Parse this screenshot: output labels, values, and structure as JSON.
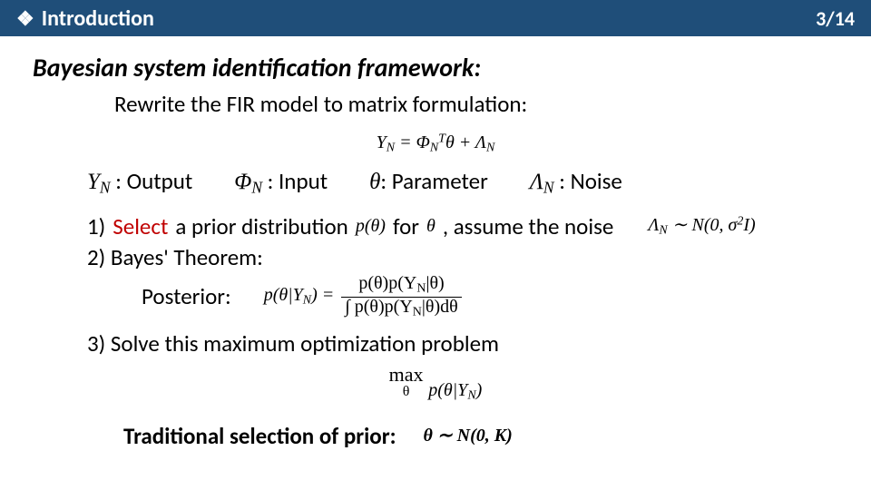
{
  "header": {
    "bullet": "❖",
    "title": "Introduction",
    "page": "3/14"
  },
  "heading": "Bayesian system identification framework:",
  "rewrite": "Rewrite the FIR model to matrix formulation:",
  "main_eq": "Y_N = Φ_N^T θ + Λ_N",
  "defs": {
    "output_sym": "Y_N",
    "output_lbl": ": Output",
    "input_sym": "Φ_N",
    "input_lbl": ": Input",
    "param_sym": "θ",
    "param_lbl": ": Parameter",
    "noise_sym": "Λ_N",
    "noise_lbl": ": Noise"
  },
  "step1_a": "1) ",
  "step1_select": "Select",
  "step1_b": " a prior distribution ",
  "step1_ptheta": "p(θ)",
  "step1_c": " for ",
  "step1_theta": "θ",
  "step1_d": ", assume the noise",
  "noise_dist": "Λ_N ∼ N(0, σ²I)",
  "step2": "2) Bayes' Theorem:",
  "posterior_lbl": "Posterior:",
  "post_lhs": "p(θ|Y_N) = ",
  "post_num": "p(θ)p(Y_N|θ)",
  "post_den": "∫ p(θ)p(Y_N|θ)dθ",
  "step3": "3) Solve this maximum optimization problem",
  "max_top": "max",
  "max_bot": "θ",
  "max_arg": " p(θ|Y_N)",
  "sel_label": "Traditional selection of prior:",
  "sel_eq": "θ ∼ N(0, K)"
}
